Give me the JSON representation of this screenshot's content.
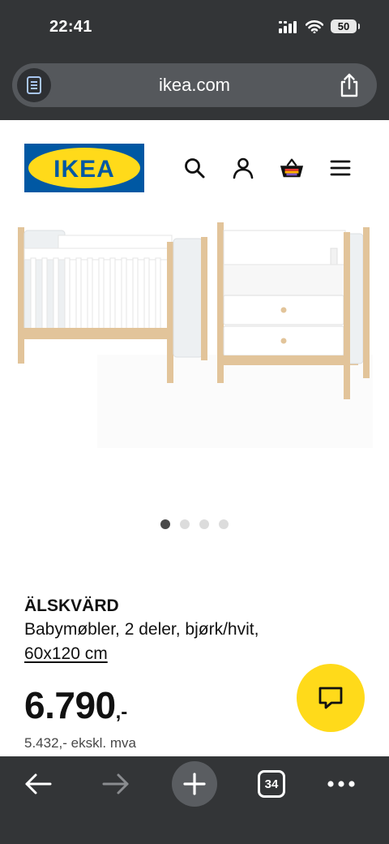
{
  "status_bar": {
    "time": "22:41",
    "battery": "50",
    "icons": [
      "cellular-signal-icon",
      "wifi-icon",
      "battery-icon"
    ]
  },
  "url_bar": {
    "domain": "ikea.com",
    "icons": [
      "reader-mode-icon",
      "share-icon"
    ]
  },
  "header": {
    "logo_text": "IKEA",
    "icons": [
      "search-icon",
      "account-icon",
      "cart-icon",
      "menu-icon"
    ],
    "colors": {
      "logo_blue": "#0058a3",
      "logo_yellow": "#ffda1a"
    }
  },
  "product": {
    "name": "ÄLSKVÄRD",
    "description": "Babymøbler, 2 deler, bjørk/hvit,",
    "size": "60x120 cm",
    "price": "6.790",
    "price_suffix": ",-",
    "price_ex_vat": "5.432,- ekskl. mva",
    "image_count": 4,
    "active_image": 1
  },
  "chat": {
    "icon": "chat-icon",
    "color": "#ffda1a"
  },
  "toolbar": {
    "tab_count": "34",
    "icons": [
      "back-arrow-icon",
      "forward-arrow-icon",
      "new-tab-icon",
      "tabs-icon",
      "more-icon"
    ]
  }
}
